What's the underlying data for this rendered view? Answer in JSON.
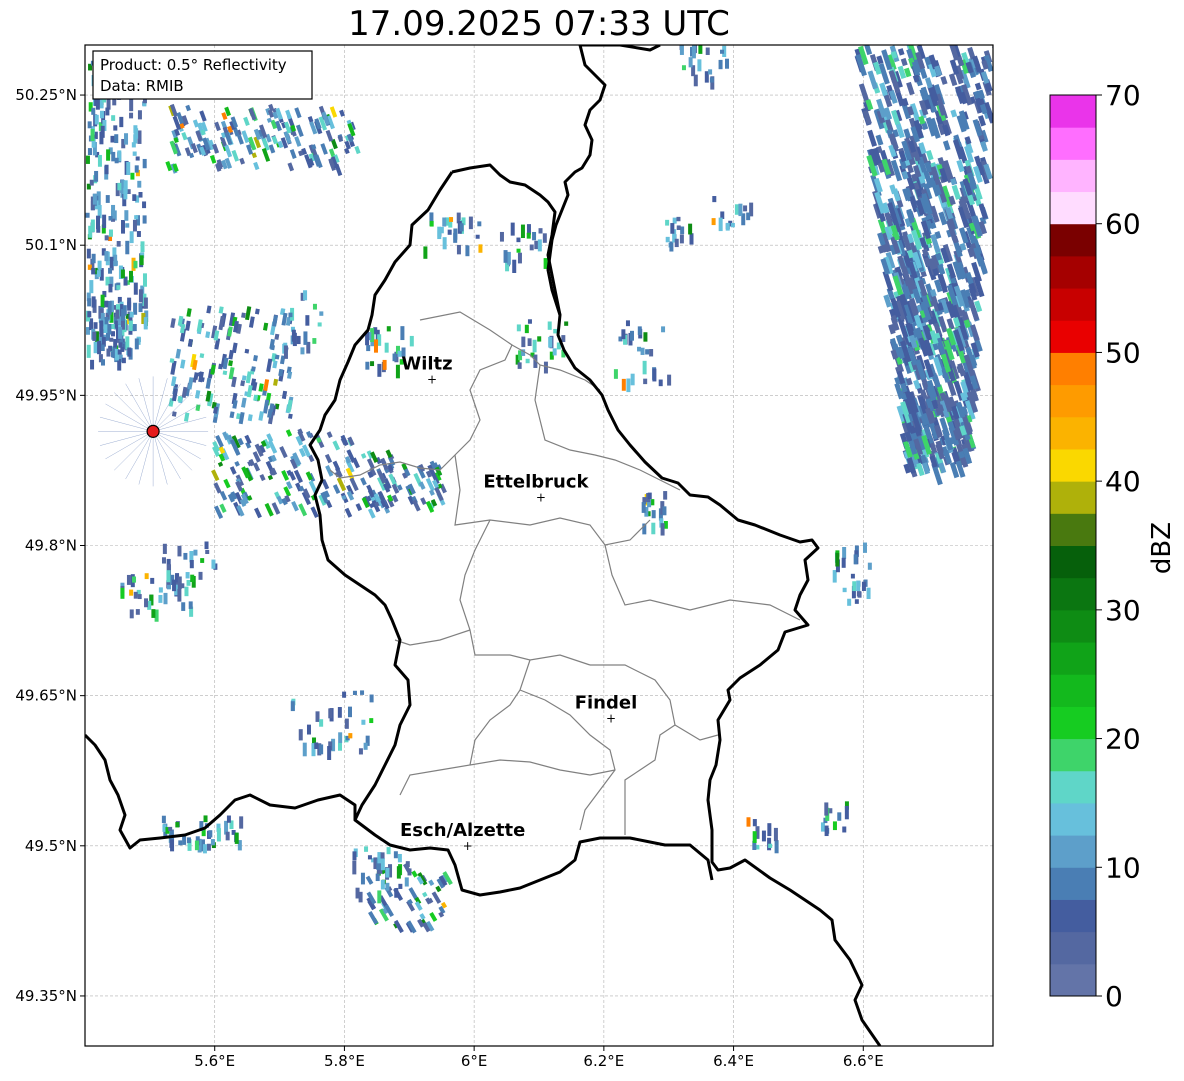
{
  "title": "17.09.2025 07:33 UTC",
  "info_box": {
    "line1": "Product: 0.5° Reflectivity",
    "line2": "Data: RMIB"
  },
  "axes": {
    "lat_labels": [
      "50.25°N",
      "50.1°N",
      "49.95°N",
      "49.8°N",
      "49.65°N",
      "49.5°N",
      "49.35°N"
    ],
    "lon_labels": [
      "5.6°E",
      "5.8°E",
      "6°E",
      "6.2°E",
      "6.4°E",
      "6.6°E"
    ],
    "grid": true
  },
  "cities": [
    {
      "name": "Wiltz",
      "lon": 5.935,
      "lat": 49.966
    },
    {
      "name": "Ettelbruck",
      "lon": 6.103,
      "lat": 49.848
    },
    {
      "name": "Findel",
      "lon": 6.211,
      "lat": 49.627
    },
    {
      "name": "Esch/Alzette",
      "lon": 5.99,
      "lat": 49.5
    }
  ],
  "radar_site": {
    "lon": 5.505,
    "lat": 49.914,
    "color": "#e41a1c"
  },
  "colorbar": {
    "label": "dBZ",
    "ticks": [
      "0",
      "10",
      "20",
      "30",
      "40",
      "50",
      "60",
      "70"
    ],
    "colors": [
      "#6374a8",
      "#5468a1",
      "#445d9f",
      "#4a7eb4",
      "#5d9fca",
      "#67c0dc",
      "#5fd6c8",
      "#3ed46a",
      "#16cc21",
      "#13b91d",
      "#10a318",
      "#0e8c14",
      "#0b7611",
      "#06600b",
      "#49790f",
      "#afb10a",
      "#fad800",
      "#fbb300",
      "#fe9b00",
      "#ff7f00",
      "#e90000",
      "#c80000",
      "#a50000",
      "#7a0000",
      "#ffdcff",
      "#ffb4ff",
      "#ff6eff",
      "#ea34ea"
    ]
  },
  "chart_data": {
    "type": "heatmap",
    "title": "17.09.2025 07:33 UTC",
    "xlim": [
      5.4,
      6.8
    ],
    "ylim": [
      49.3,
      50.3
    ],
    "xticks": [
      5.6,
      5.8,
      6.0,
      6.2,
      6.4,
      6.6
    ],
    "yticks": [
      49.35,
      49.5,
      49.65,
      49.8,
      49.95,
      50.1,
      50.25
    ],
    "value_range": [
      0,
      70
    ],
    "value_unit": "dBZ"
  }
}
